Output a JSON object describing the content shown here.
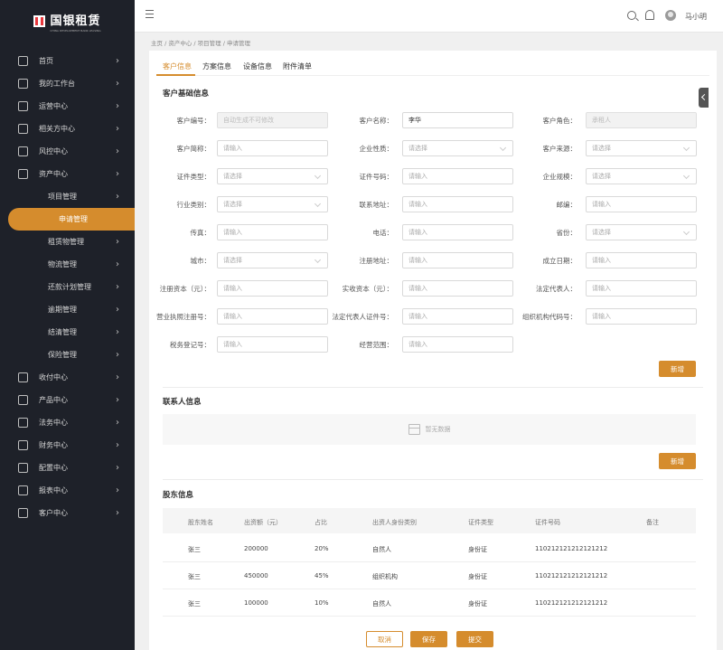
{
  "app": {
    "logo_text": "国银租赁",
    "logo_sub": "CHINA DEVELOPMENT BANK LEASING"
  },
  "sidebar": {
    "items": [
      {
        "label": "首页",
        "icon": "home-icon"
      },
      {
        "label": "我的工作台",
        "icon": "workbench-icon"
      },
      {
        "label": "运营中心",
        "icon": "operation-icon"
      },
      {
        "label": "相关方中心",
        "icon": "tag-icon"
      },
      {
        "label": "风控中心",
        "icon": "shield-icon"
      },
      {
        "label": "资产中心",
        "icon": "asset-icon"
      },
      {
        "label": "项目管理",
        "sub": true
      },
      {
        "label": "申请管理",
        "sub": true,
        "active": true
      },
      {
        "label": "租赁物管理",
        "sub": true
      },
      {
        "label": "物流管理",
        "sub": true
      },
      {
        "label": "还款计划管理",
        "sub": true
      },
      {
        "label": "逾期管理",
        "sub": true
      },
      {
        "label": "结清管理",
        "sub": true
      },
      {
        "label": "保险管理",
        "sub": true
      },
      {
        "label": "收付中心",
        "icon": "payment-icon"
      },
      {
        "label": "产品中心",
        "icon": "product-icon"
      },
      {
        "label": "法务中心",
        "icon": "legal-icon"
      },
      {
        "label": "财务中心",
        "icon": "finance-icon"
      },
      {
        "label": "配置中心",
        "icon": "config-icon"
      },
      {
        "label": "报表中心",
        "icon": "report-icon"
      },
      {
        "label": "客户中心",
        "icon": "customer-icon"
      }
    ]
  },
  "topbar": {
    "username": "马小明"
  },
  "breadcrumb": "主页 / 资产中心 / 项目管理 / 申请管理",
  "tabs": [
    "客户信息",
    "方案信息",
    "设备信息",
    "附件清单"
  ],
  "section1": {
    "title": "客户基础信息"
  },
  "fields": [
    {
      "label": "客户编号：",
      "value": "",
      "placeholder": "自动生成不可修改",
      "kind": "disabled"
    },
    {
      "label": "客户名称：",
      "value": "李华",
      "placeholder": "",
      "kind": "filled"
    },
    {
      "label": "客户角色：",
      "value": "",
      "placeholder": "承租人",
      "kind": "disabled"
    },
    {
      "label": "客户简称：",
      "value": "",
      "placeholder": "请输入",
      "kind": "input"
    },
    {
      "label": "企业性质：",
      "value": "",
      "placeholder": "请选择",
      "kind": "select"
    },
    {
      "label": "客户来源：",
      "value": "",
      "placeholder": "请选择",
      "kind": "select"
    },
    {
      "label": "证件类型：",
      "value": "",
      "placeholder": "请选择",
      "kind": "select"
    },
    {
      "label": "证件号码：",
      "value": "",
      "placeholder": "请输入",
      "kind": "input"
    },
    {
      "label": "企业规模：",
      "value": "",
      "placeholder": "请选择",
      "kind": "select"
    },
    {
      "label": "行业类别：",
      "value": "",
      "placeholder": "请选择",
      "kind": "select"
    },
    {
      "label": "联系地址：",
      "value": "",
      "placeholder": "请输入",
      "kind": "input"
    },
    {
      "label": "邮编：",
      "value": "",
      "placeholder": "请输入",
      "kind": "input"
    },
    {
      "label": "传真：",
      "value": "",
      "placeholder": "请输入",
      "kind": "input"
    },
    {
      "label": "电话：",
      "value": "",
      "placeholder": "请输入",
      "kind": "input"
    },
    {
      "label": "省份：",
      "value": "",
      "placeholder": "请选择",
      "kind": "select"
    },
    {
      "label": "城市：",
      "value": "",
      "placeholder": "请选择",
      "kind": "select"
    },
    {
      "label": "注册地址：",
      "value": "",
      "placeholder": "请输入",
      "kind": "input"
    },
    {
      "label": "成立日期：",
      "value": "",
      "placeholder": "请输入",
      "kind": "input"
    },
    {
      "label": "注册资本（元）：",
      "value": "",
      "placeholder": "请输入",
      "kind": "input"
    },
    {
      "label": "实收资本（元）：",
      "value": "",
      "placeholder": "请输入",
      "kind": "input"
    },
    {
      "label": "法定代表人：",
      "value": "",
      "placeholder": "请输入",
      "kind": "input"
    },
    {
      "label": "营业执照注册号：",
      "value": "",
      "placeholder": "请输入",
      "kind": "input"
    },
    {
      "label": "法定代表人证件号：",
      "value": "",
      "placeholder": "请输入",
      "kind": "input"
    },
    {
      "label": "组织机构代码号：",
      "value": "",
      "placeholder": "请输入",
      "kind": "input"
    },
    {
      "label": "税务登记号：",
      "value": "",
      "placeholder": "请输入",
      "kind": "input"
    },
    {
      "label": "经营范围：",
      "value": "",
      "placeholder": "请输入",
      "kind": "input"
    }
  ],
  "add_label": "新增",
  "section2": {
    "title": "联系人信息",
    "empty": "暂无数据"
  },
  "section3": {
    "title": "股东信息"
  },
  "table": {
    "headers": [
      "股东姓名",
      "出资额（元）",
      "占比",
      "出资人身份类别",
      "证件类型",
      "证件号码",
      "备注"
    ],
    "rows": [
      [
        "张三",
        "200000",
        "20%",
        "自然人",
        "身份证",
        "110212121212121212",
        ""
      ],
      [
        "张三",
        "450000",
        "45%",
        "组织机构",
        "身份证",
        "110212121212121212",
        ""
      ],
      [
        "张三",
        "100000",
        "10%",
        "自然人",
        "身份证",
        "110212121212121212",
        ""
      ]
    ]
  },
  "actions": {
    "cancel": "取消",
    "save": "保存",
    "submit": "提交"
  },
  "colors": {
    "accent": "#d58c2d",
    "sidebar": "#1e2129"
  }
}
